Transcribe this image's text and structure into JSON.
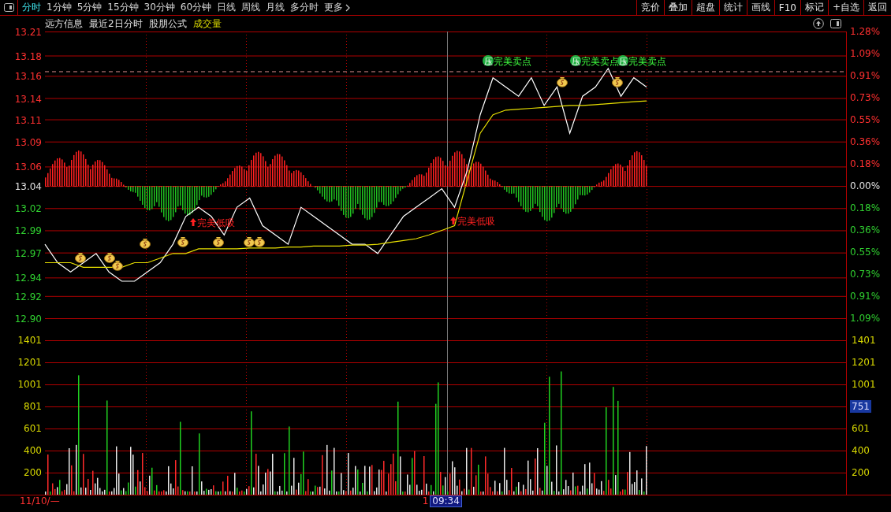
{
  "toolbar": {
    "periods": [
      {
        "label": "分时",
        "selected": true,
        "dropdown": false
      },
      {
        "label": "1分钟",
        "selected": false,
        "dropdown": false
      },
      {
        "label": "5分钟",
        "selected": false,
        "dropdown": false
      },
      {
        "label": "15分钟",
        "selected": false,
        "dropdown": false
      },
      {
        "label": "30分钟",
        "selected": false,
        "dropdown": false
      },
      {
        "label": "60分钟",
        "selected": false,
        "dropdown": false
      },
      {
        "label": "日线",
        "selected": false,
        "dropdown": false
      },
      {
        "label": "周线",
        "selected": false,
        "dropdown": false
      },
      {
        "label": "月线",
        "selected": false,
        "dropdown": false
      },
      {
        "label": "多分时",
        "selected": false,
        "dropdown": false
      },
      {
        "label": "更多",
        "selected": false,
        "dropdown": true
      }
    ],
    "buttons": [
      "竞价",
      "叠加",
      "超盘",
      "统计",
      "画线",
      "F10",
      "标记",
      "+自选",
      "返回"
    ]
  },
  "header": {
    "stock": "远方信息",
    "period": "最近2日分时",
    "formula": "股朋公式",
    "indicator": "成交量"
  },
  "chart": {
    "chart_data": {
      "type": "line",
      "ylim": [
        12.9,
        13.21
      ],
      "grid": true,
      "yticks": [
        {
          "value": 13.21,
          "label": "13.21"
        },
        {
          "value": 13.184,
          "label": "13.18"
        },
        {
          "value": 13.162,
          "label": "13.16"
        },
        {
          "value": 13.138,
          "label": "13.14"
        },
        {
          "value": 13.115,
          "label": "13.11"
        },
        {
          "value": 13.091,
          "label": "13.09"
        },
        {
          "value": 13.064,
          "label": "13.06"
        },
        {
          "value": 13.043,
          "label": "13.04"
        },
        {
          "value": 13.019,
          "label": "13.02"
        },
        {
          "value": 12.995,
          "label": "12.99"
        },
        {
          "value": 12.971,
          "label": "12.97"
        },
        {
          "value": 12.944,
          "label": "12.94"
        },
        {
          "value": 12.924,
          "label": "12.92"
        },
        {
          "value": 12.9,
          "label": "12.90"
        }
      ],
      "series": [
        {
          "color": "#ffffff",
          "values": [
            12.98,
            12.96,
            12.95,
            12.96,
            12.97,
            12.95,
            12.94,
            12.94,
            12.95,
            12.96,
            12.98,
            13.01,
            13.02,
            13.01,
            12.99,
            13.02,
            13.03,
            13.0,
            12.99,
            12.98,
            13.02,
            13.01,
            13.0,
            12.99,
            12.98,
            12.98,
            12.97,
            12.99,
            13.01,
            13.02,
            13.03,
            13.04,
            13.02,
            13.06,
            13.12,
            13.16,
            13.15,
            13.14,
            13.16,
            13.13,
            13.15,
            13.1,
            13.14,
            13.15,
            13.17,
            13.14,
            13.16,
            13.15
          ]
        },
        {
          "color": "#e8e000",
          "values": [
            12.96,
            12.96,
            12.96,
            12.955,
            12.955,
            12.955,
            12.955,
            12.96,
            12.96,
            12.965,
            12.97,
            12.97,
            12.975,
            12.975,
            12.975,
            12.975,
            12.976,
            12.976,
            12.976,
            12.977,
            12.977,
            12.978,
            12.978,
            12.978,
            12.979,
            12.979,
            12.98,
            12.982,
            12.984,
            12.986,
            12.99,
            12.995,
            13.0,
            13.05,
            13.1,
            13.12,
            13.125,
            13.126,
            13.127,
            13.128,
            13.129,
            13.13,
            13.13,
            13.131,
            13.132,
            13.133,
            13.134,
            13.135
          ]
        }
      ]
    },
    "sell_signals": [
      {
        "badge": "压",
        "label": "完美卖点"
      },
      {
        "badge": "压",
        "label": "完美卖点"
      },
      {
        "badge": "压",
        "label": "完美卖点"
      }
    ],
    "buy_signals": [
      {
        "label": "完美低吸"
      },
      {
        "label": "完美低吸"
      }
    ]
  },
  "volume_labels": [
    "1401",
    "1201",
    "1001",
    "801",
    "601",
    "400",
    "200"
  ],
  "right_axis": {
    "percent_labels": [
      {
        "text": "1.28%",
        "kind": "up"
      },
      {
        "text": "1.09%",
        "kind": "up"
      },
      {
        "text": "0.91%",
        "kind": "up"
      },
      {
        "text": "0.73%",
        "kind": "up"
      },
      {
        "text": "0.55%",
        "kind": "up"
      },
      {
        "text": "0.36%",
        "kind": "up"
      },
      {
        "text": "0.18%",
        "kind": "up"
      },
      {
        "text": "0.00%",
        "kind": "flat"
      },
      {
        "text": "0.18%",
        "kind": "down"
      },
      {
        "text": "0.36%",
        "kind": "down"
      },
      {
        "text": "0.55%",
        "kind": "down"
      },
      {
        "text": "0.73%",
        "kind": "down"
      },
      {
        "text": "0.91%",
        "kind": "down"
      },
      {
        "text": "1.09%",
        "kind": "down"
      }
    ],
    "volume_labels": [
      {
        "text": "1401",
        "highlighted": false
      },
      {
        "text": "1201",
        "highlighted": false
      },
      {
        "text": "1001",
        "highlighted": false
      },
      {
        "text": "751",
        "highlighted": true
      },
      {
        "text": "601",
        "highlighted": false
      },
      {
        "text": "400",
        "highlighted": false
      },
      {
        "text": "200",
        "highlighted": false
      }
    ]
  },
  "time_bar": {
    "date": "11/10/—",
    "marker": "1",
    "cursor_time": "09:34"
  }
}
